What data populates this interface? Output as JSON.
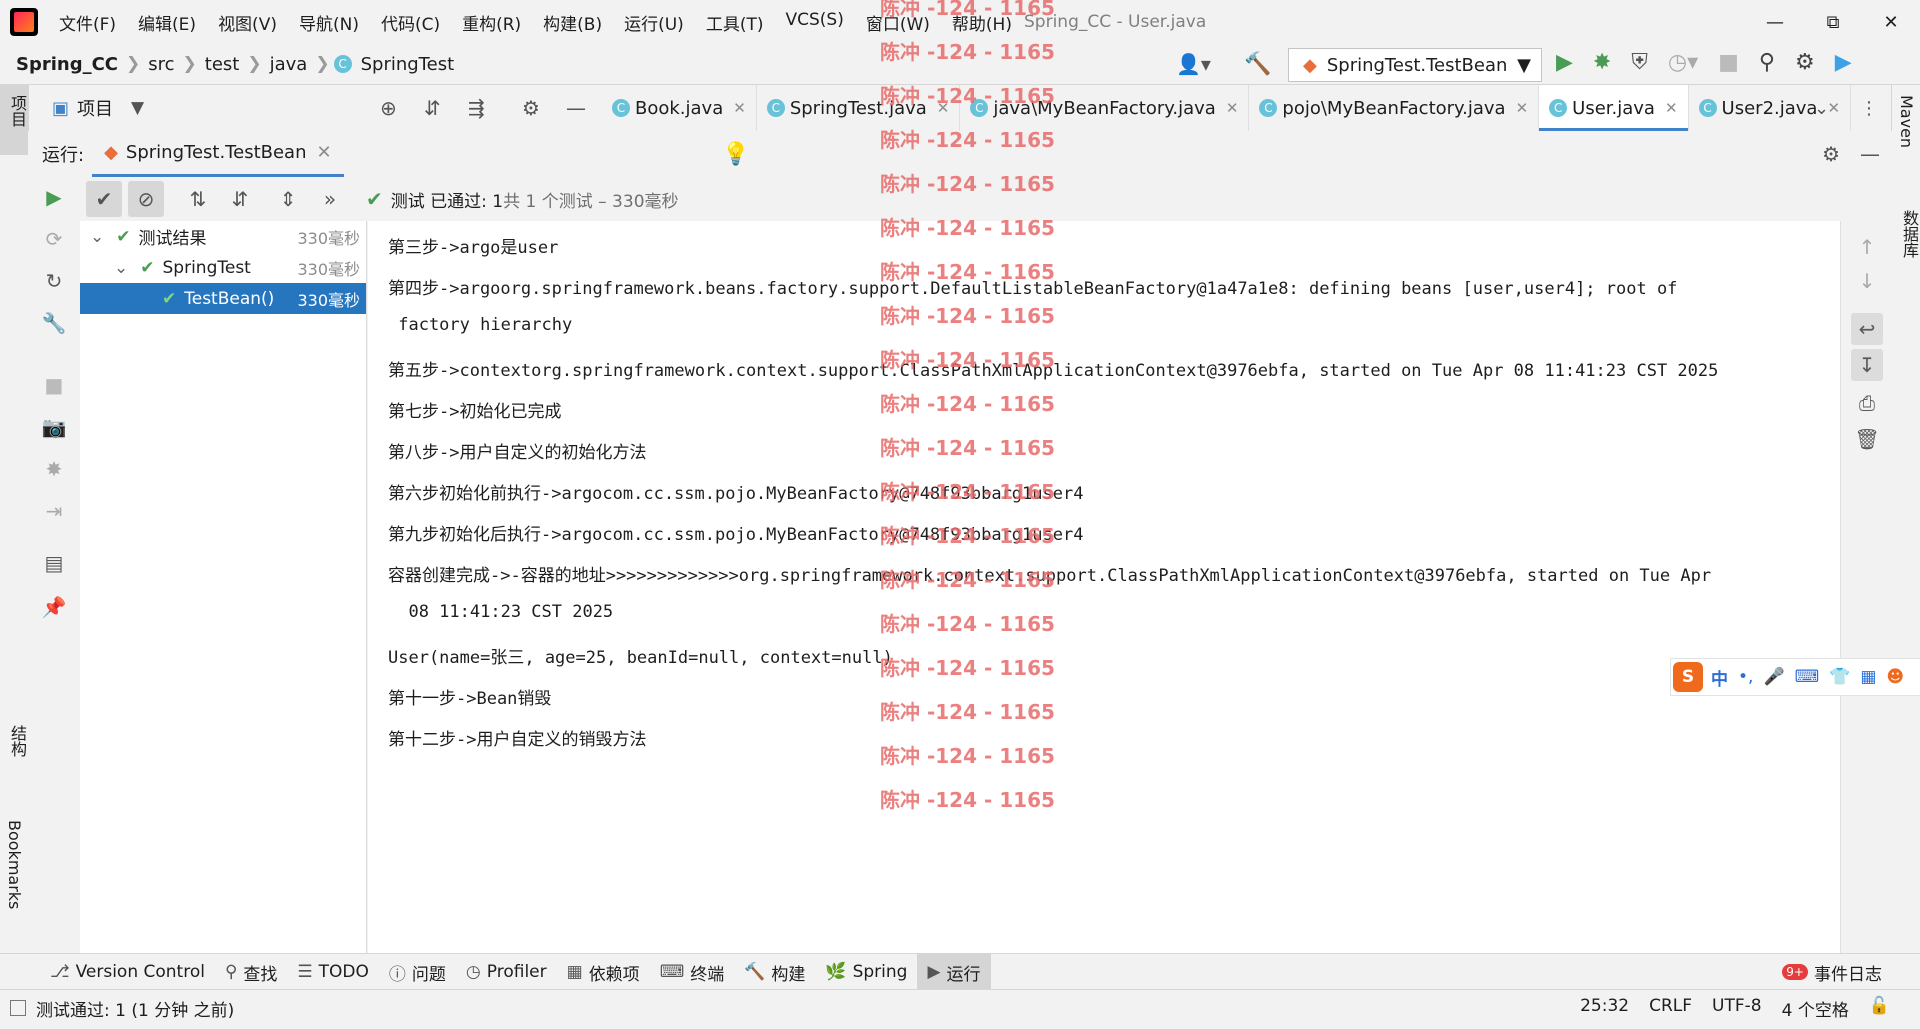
{
  "window": {
    "title": "Spring_CC - User.java",
    "menu": [
      "文件(F)",
      "编辑(E)",
      "视图(V)",
      "导航(N)",
      "代码(C)",
      "重构(R)",
      "构建(B)",
      "运行(U)",
      "工具(T)",
      "VCS(S)",
      "窗口(W)",
      "帮助(H)"
    ]
  },
  "nav": {
    "breadcrumbs": [
      "Spring_CC",
      "src",
      "test",
      "java",
      "SpringTest"
    ],
    "run_config": "SpringTest.TestBean"
  },
  "project_panel": {
    "label": "项目"
  },
  "editor_tabs": [
    {
      "label": "Book.java",
      "active": false
    },
    {
      "label": "SpringTest.java",
      "active": false
    },
    {
      "label": "java\\MyBeanFactory.java",
      "active": false
    },
    {
      "label": "pojo\\MyBeanFactory.java",
      "active": false
    },
    {
      "label": "User.java",
      "active": true
    },
    {
      "label": "User2.java",
      "active": false
    }
  ],
  "run_panel": {
    "label": "运行:",
    "tab": "SpringTest.TestBean",
    "status_prefix": "测试 已通过: 1",
    "status_suffix": "共 1 个测试 – 330毫秒"
  },
  "tree": [
    {
      "label": "测试结果",
      "duration": "330毫秒",
      "level": 0
    },
    {
      "label": "SpringTest",
      "duration": "330毫秒",
      "level": 1
    },
    {
      "label": "TestBean()",
      "duration": "330毫秒",
      "level": 2
    }
  ],
  "console": [
    "第三步->argo是user",
    "第四步->argoorg.springframework.beans.factory.support.DefaultListableBeanFactory@1a47a1e8: defining beans [user,user4]; root of",
    " factory hierarchy",
    "第五步->contextorg.springframework.context.support.ClassPathXmlApplicationContext@3976ebfa, started on Tue Apr 08 11:41:23 CST 2025",
    "第七步->初始化已完成",
    "第八步->用户自定义的初始化方法",
    "第六步初始化前执行->argocom.cc.ssm.pojo.MyBeanFactory@748f93bbarg1user4",
    "第九步初始化后执行->argocom.cc.ssm.pojo.MyBeanFactory@748f93bbarg1user4",
    "容器创建完成->-容器的地址>>>>>>>>>>>>>org.springframework.context.support.ClassPathXmlApplicationContext@3976ebfa, started on Tue Apr",
    "  08 11:41:23 CST 2025",
    "User(name=张三, age=25, beanId=null, context=null)",
    "第十一步->Bean销毁",
    "第十二步->用户自定义的销毁方法"
  ],
  "side_labels": {
    "maven": "Maven",
    "database": "数据库",
    "structure": "结构",
    "bookmarks": "Bookmarks"
  },
  "bottom_tools": [
    "Version Control",
    "查找",
    "TODO",
    "问题",
    "Profiler",
    "依赖项",
    "终端",
    "构建",
    "Spring",
    "运行"
  ],
  "event_log": {
    "badge": "9+",
    "label": "事件日志"
  },
  "statusbar": {
    "message": "测试通过: 1 (1 分钟 之前)",
    "position": "25:32",
    "line_sep": "CRLF",
    "encoding": "UTF-8",
    "indent": "4 个空格"
  },
  "watermark": "陈冲 -124 - 1165",
  "ime": {
    "label": "中"
  }
}
